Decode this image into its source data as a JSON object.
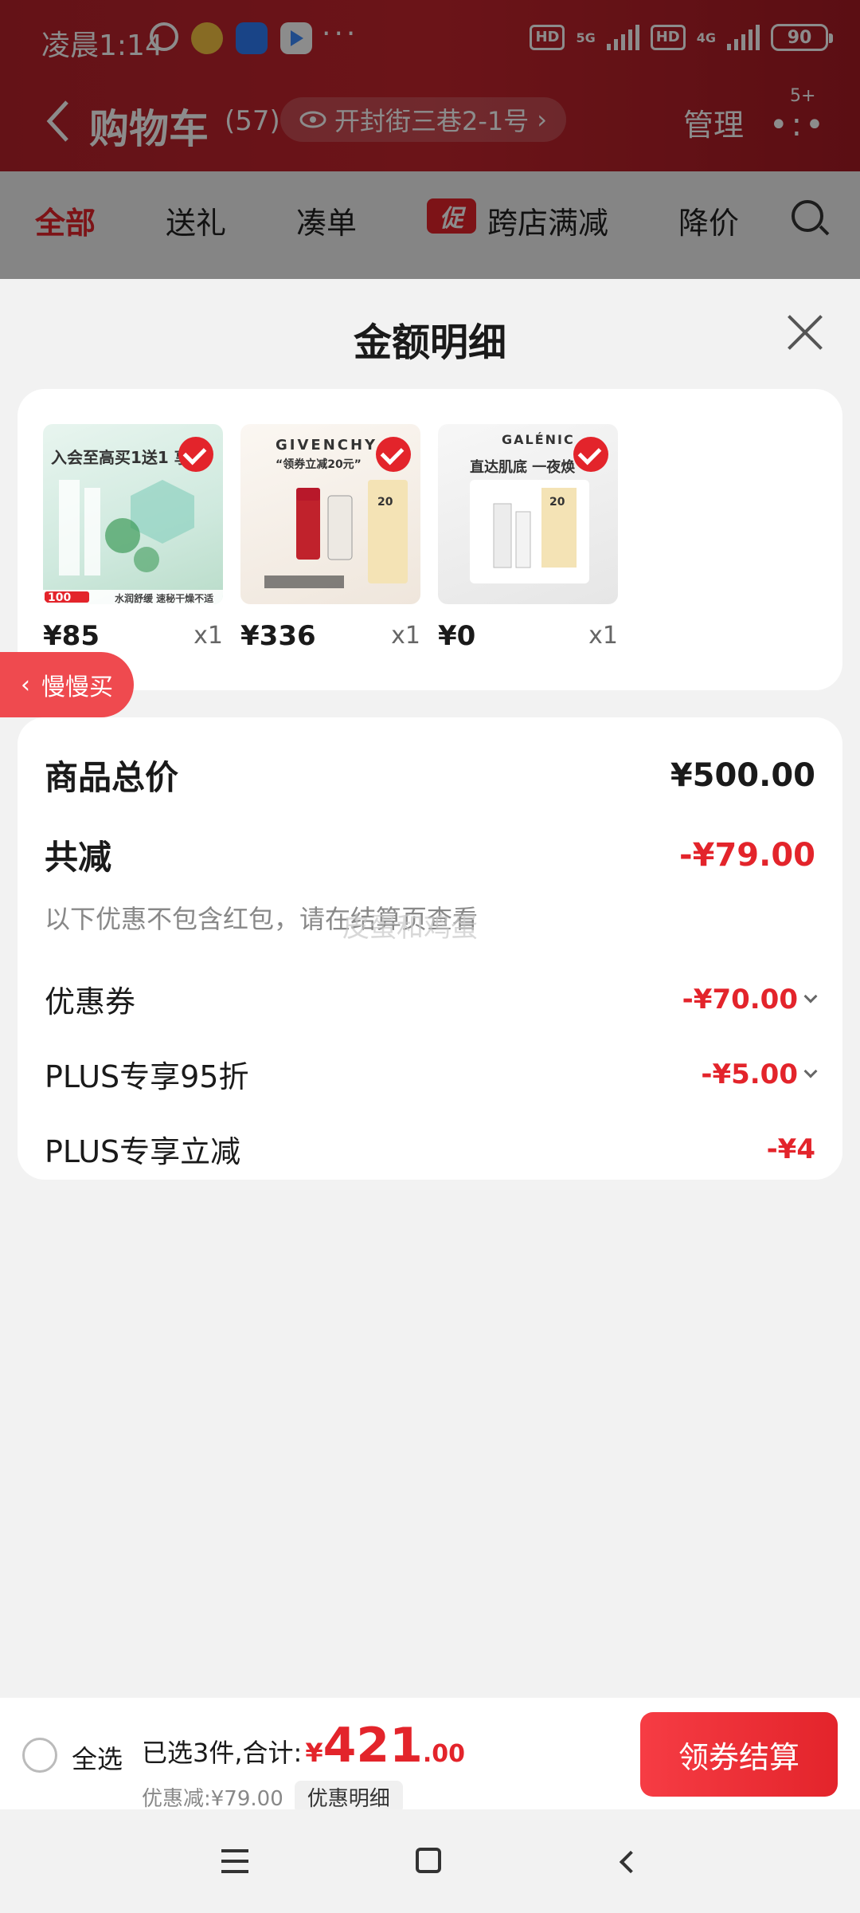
{
  "status_bar": {
    "time": "凌晨1:14",
    "dots": "···",
    "hd1": "HD",
    "net1": "5G",
    "hd2": "HD",
    "net2": "4G",
    "battery": "90"
  },
  "header": {
    "title": "购物车",
    "count": "(57)",
    "address": "开封街三巷2-1号",
    "manage": "管理",
    "more_badge": "5+"
  },
  "tabs": {
    "all": "全部",
    "gift": "送礼",
    "bundle": "凑单",
    "promo_tag": "促",
    "cross_store": "跨店满减",
    "price_drop": "降价"
  },
  "sheet": {
    "title": "金额明细",
    "products": [
      {
        "price": "¥85",
        "qty": "x1",
        "img_caption_top": "入会至高买1送1 享",
        "img_caption_bottom": "水润舒缓 速秘干燥不适",
        "img_badge": "100"
      },
      {
        "price": "¥336",
        "qty": "x1",
        "img_caption_top": "GIVENCHY",
        "img_caption_sub": "“领券立减20元”",
        "img_badge": "20"
      },
      {
        "price": "¥0",
        "qty": "x1",
        "img_caption_top": "GALÉNIC",
        "img_caption_sub": "直达肌底 一夜焕",
        "img_badge": "20"
      }
    ],
    "slow_buy": "慢慢买",
    "detail": {
      "total_label": "商品总价",
      "total_value": "¥500.00",
      "reduce_label": "共减",
      "reduce_value": "-¥79.00",
      "note": "以下优惠不包含红包，请在结算页查看",
      "watermark": "皮蛋和鸡蛋",
      "coupon_label": "优惠券",
      "coupon_value": "-¥70.00",
      "plus95_label": "PLUS专享95折",
      "plus95_value": "-¥5.00",
      "plus_cut_label": "PLUS专享立减",
      "plus_cut_value": "-¥4"
    }
  },
  "bottom": {
    "select_all": "全选",
    "selected_text": "已选3件,合计:",
    "currency": "¥",
    "total_int": "421",
    "total_dec": ".00",
    "discount_text": "优惠减:¥79.00",
    "detail_pill": "优惠明细",
    "checkout": "领券结算"
  }
}
